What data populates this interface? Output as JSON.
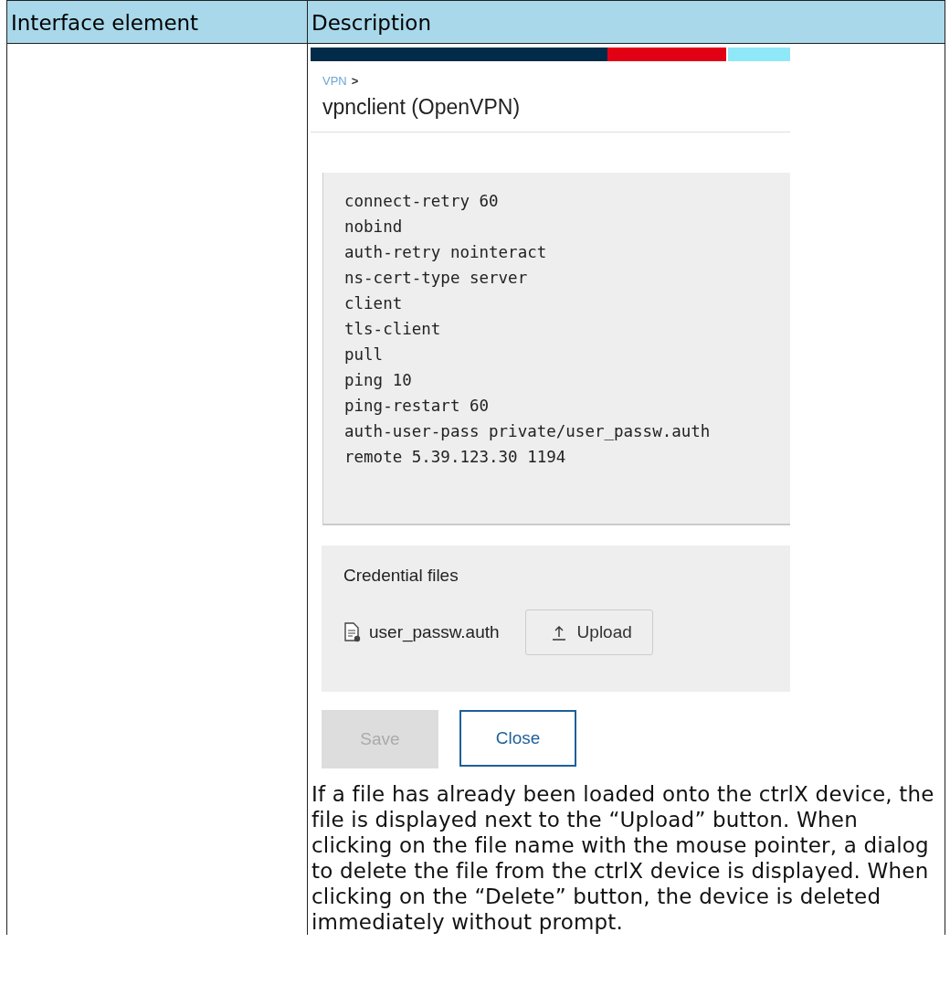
{
  "table": {
    "columns": [
      "Interface element",
      "Description"
    ],
    "rows": [
      {
        "element": "",
        "screenshot": {
          "breadcrumb": "VPN",
          "breadcrumb_sep": ">",
          "title": "vpnclient (OpenVPN)",
          "config_lines": [
            "connect-retry 60",
            "nobind",
            "auth-retry nointeract",
            "ns-cert-type server",
            "client",
            "tls-client",
            "pull",
            "ping 10",
            "ping-restart 60",
            "auth-user-pass private/user_passw.auth",
            "remote 5.39.123.30 1194"
          ],
          "credentials": {
            "heading": "Credential files",
            "file": "user_passw.auth",
            "upload": "Upload"
          },
          "buttons": [
            {
              "label": "Save",
              "disabled": true
            },
            {
              "label": "Close",
              "disabled": false
            }
          ]
        },
        "description": "If a file has already been loaded onto the ctrlX device, the file is displayed next to the “Upload” button. When clicking on the file name with the mouse pointer, a dialog to delete the file from the ctrlX device is displayed. When clicking on the “Delete” button, the device is deleted immediately without prompt."
      }
    ]
  }
}
